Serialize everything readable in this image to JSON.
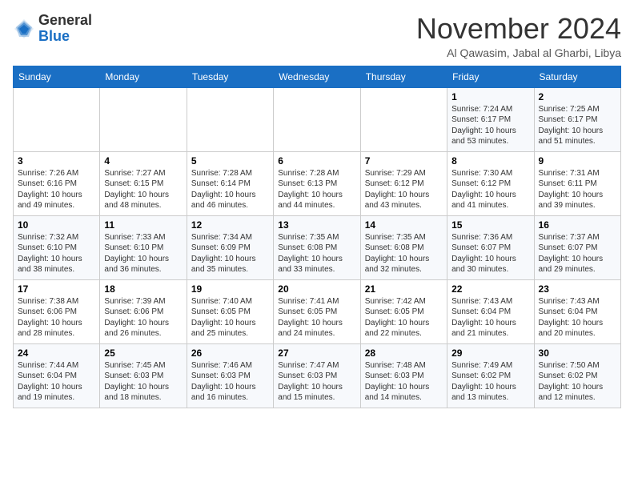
{
  "header": {
    "logo_general": "General",
    "logo_blue": "Blue",
    "month_title": "November 2024",
    "location": "Al Qawasim, Jabal al Gharbi, Libya"
  },
  "weekdays": [
    "Sunday",
    "Monday",
    "Tuesday",
    "Wednesday",
    "Thursday",
    "Friday",
    "Saturday"
  ],
  "weeks": [
    [
      {
        "day": "",
        "info": ""
      },
      {
        "day": "",
        "info": ""
      },
      {
        "day": "",
        "info": ""
      },
      {
        "day": "",
        "info": ""
      },
      {
        "day": "",
        "info": ""
      },
      {
        "day": "1",
        "info": "Sunrise: 7:24 AM\nSunset: 6:17 PM\nDaylight: 10 hours\nand 53 minutes."
      },
      {
        "day": "2",
        "info": "Sunrise: 7:25 AM\nSunset: 6:17 PM\nDaylight: 10 hours\nand 51 minutes."
      }
    ],
    [
      {
        "day": "3",
        "info": "Sunrise: 7:26 AM\nSunset: 6:16 PM\nDaylight: 10 hours\nand 49 minutes."
      },
      {
        "day": "4",
        "info": "Sunrise: 7:27 AM\nSunset: 6:15 PM\nDaylight: 10 hours\nand 48 minutes."
      },
      {
        "day": "5",
        "info": "Sunrise: 7:28 AM\nSunset: 6:14 PM\nDaylight: 10 hours\nand 46 minutes."
      },
      {
        "day": "6",
        "info": "Sunrise: 7:28 AM\nSunset: 6:13 PM\nDaylight: 10 hours\nand 44 minutes."
      },
      {
        "day": "7",
        "info": "Sunrise: 7:29 AM\nSunset: 6:12 PM\nDaylight: 10 hours\nand 43 minutes."
      },
      {
        "day": "8",
        "info": "Sunrise: 7:30 AM\nSunset: 6:12 PM\nDaylight: 10 hours\nand 41 minutes."
      },
      {
        "day": "9",
        "info": "Sunrise: 7:31 AM\nSunset: 6:11 PM\nDaylight: 10 hours\nand 39 minutes."
      }
    ],
    [
      {
        "day": "10",
        "info": "Sunrise: 7:32 AM\nSunset: 6:10 PM\nDaylight: 10 hours\nand 38 minutes."
      },
      {
        "day": "11",
        "info": "Sunrise: 7:33 AM\nSunset: 6:10 PM\nDaylight: 10 hours\nand 36 minutes."
      },
      {
        "day": "12",
        "info": "Sunrise: 7:34 AM\nSunset: 6:09 PM\nDaylight: 10 hours\nand 35 minutes."
      },
      {
        "day": "13",
        "info": "Sunrise: 7:35 AM\nSunset: 6:08 PM\nDaylight: 10 hours\nand 33 minutes."
      },
      {
        "day": "14",
        "info": "Sunrise: 7:35 AM\nSunset: 6:08 PM\nDaylight: 10 hours\nand 32 minutes."
      },
      {
        "day": "15",
        "info": "Sunrise: 7:36 AM\nSunset: 6:07 PM\nDaylight: 10 hours\nand 30 minutes."
      },
      {
        "day": "16",
        "info": "Sunrise: 7:37 AM\nSunset: 6:07 PM\nDaylight: 10 hours\nand 29 minutes."
      }
    ],
    [
      {
        "day": "17",
        "info": "Sunrise: 7:38 AM\nSunset: 6:06 PM\nDaylight: 10 hours\nand 28 minutes."
      },
      {
        "day": "18",
        "info": "Sunrise: 7:39 AM\nSunset: 6:06 PM\nDaylight: 10 hours\nand 26 minutes."
      },
      {
        "day": "19",
        "info": "Sunrise: 7:40 AM\nSunset: 6:05 PM\nDaylight: 10 hours\nand 25 minutes."
      },
      {
        "day": "20",
        "info": "Sunrise: 7:41 AM\nSunset: 6:05 PM\nDaylight: 10 hours\nand 24 minutes."
      },
      {
        "day": "21",
        "info": "Sunrise: 7:42 AM\nSunset: 6:05 PM\nDaylight: 10 hours\nand 22 minutes."
      },
      {
        "day": "22",
        "info": "Sunrise: 7:43 AM\nSunset: 6:04 PM\nDaylight: 10 hours\nand 21 minutes."
      },
      {
        "day": "23",
        "info": "Sunrise: 7:43 AM\nSunset: 6:04 PM\nDaylight: 10 hours\nand 20 minutes."
      }
    ],
    [
      {
        "day": "24",
        "info": "Sunrise: 7:44 AM\nSunset: 6:04 PM\nDaylight: 10 hours\nand 19 minutes."
      },
      {
        "day": "25",
        "info": "Sunrise: 7:45 AM\nSunset: 6:03 PM\nDaylight: 10 hours\nand 18 minutes."
      },
      {
        "day": "26",
        "info": "Sunrise: 7:46 AM\nSunset: 6:03 PM\nDaylight: 10 hours\nand 16 minutes."
      },
      {
        "day": "27",
        "info": "Sunrise: 7:47 AM\nSunset: 6:03 PM\nDaylight: 10 hours\nand 15 minutes."
      },
      {
        "day": "28",
        "info": "Sunrise: 7:48 AM\nSunset: 6:03 PM\nDaylight: 10 hours\nand 14 minutes."
      },
      {
        "day": "29",
        "info": "Sunrise: 7:49 AM\nSunset: 6:02 PM\nDaylight: 10 hours\nand 13 minutes."
      },
      {
        "day": "30",
        "info": "Sunrise: 7:50 AM\nSunset: 6:02 PM\nDaylight: 10 hours\nand 12 minutes."
      }
    ]
  ]
}
